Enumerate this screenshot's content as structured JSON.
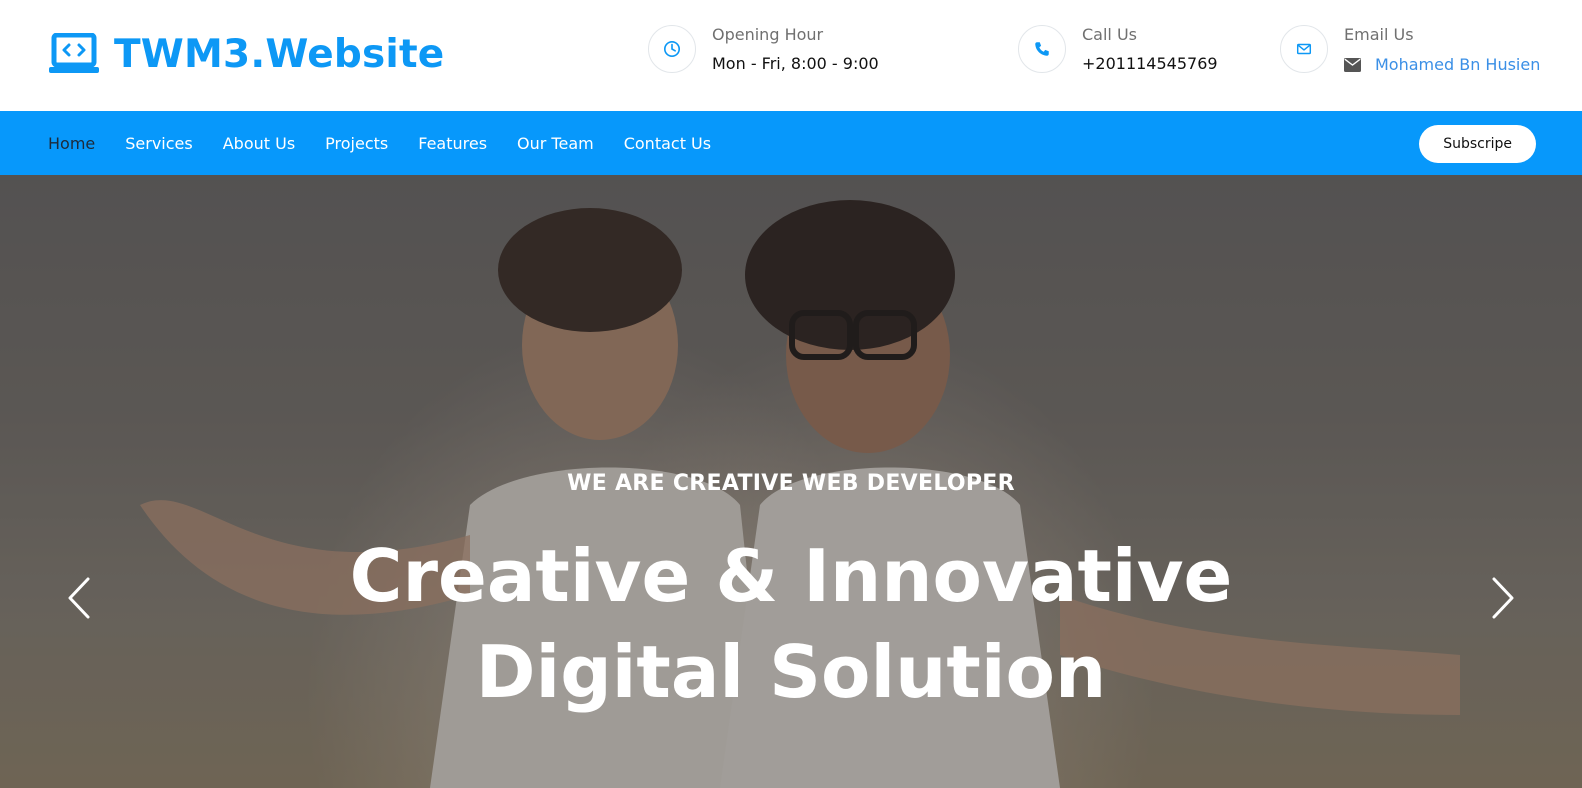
{
  "brand": {
    "name": "TWM3.Website",
    "icon": "laptop-code-icon"
  },
  "header_info": [
    {
      "icon": "clock-icon",
      "label": "Opening Hour",
      "value": "Mon - Fri, 8:00 - 9:00"
    },
    {
      "icon": "phone-icon",
      "label": "Call Us",
      "value": "+201114545769"
    },
    {
      "icon": "envelope-icon",
      "label": "Email Us",
      "value": "Mohamed Bn Husien",
      "value_icon": "envelope-solid-icon"
    }
  ],
  "nav": {
    "items": [
      {
        "label": "Home",
        "active": true
      },
      {
        "label": "Services"
      },
      {
        "label": "About Us"
      },
      {
        "label": "Projects"
      },
      {
        "label": "Features"
      },
      {
        "label": "Our Team"
      },
      {
        "label": "Contact Us"
      }
    ],
    "cta_label": "Subscripe"
  },
  "hero": {
    "kicker": "WE ARE CREATIVE WEB DEVELOPER",
    "title_line1": "Creative & Innovative",
    "title_line2": "Digital Solution",
    "prev_icon": "chevron-left-icon",
    "next_icon": "chevron-right-icon"
  },
  "colors": {
    "accent": "#0798fb",
    "brand_text": "#0d98f5",
    "link": "#3a8fe6"
  }
}
